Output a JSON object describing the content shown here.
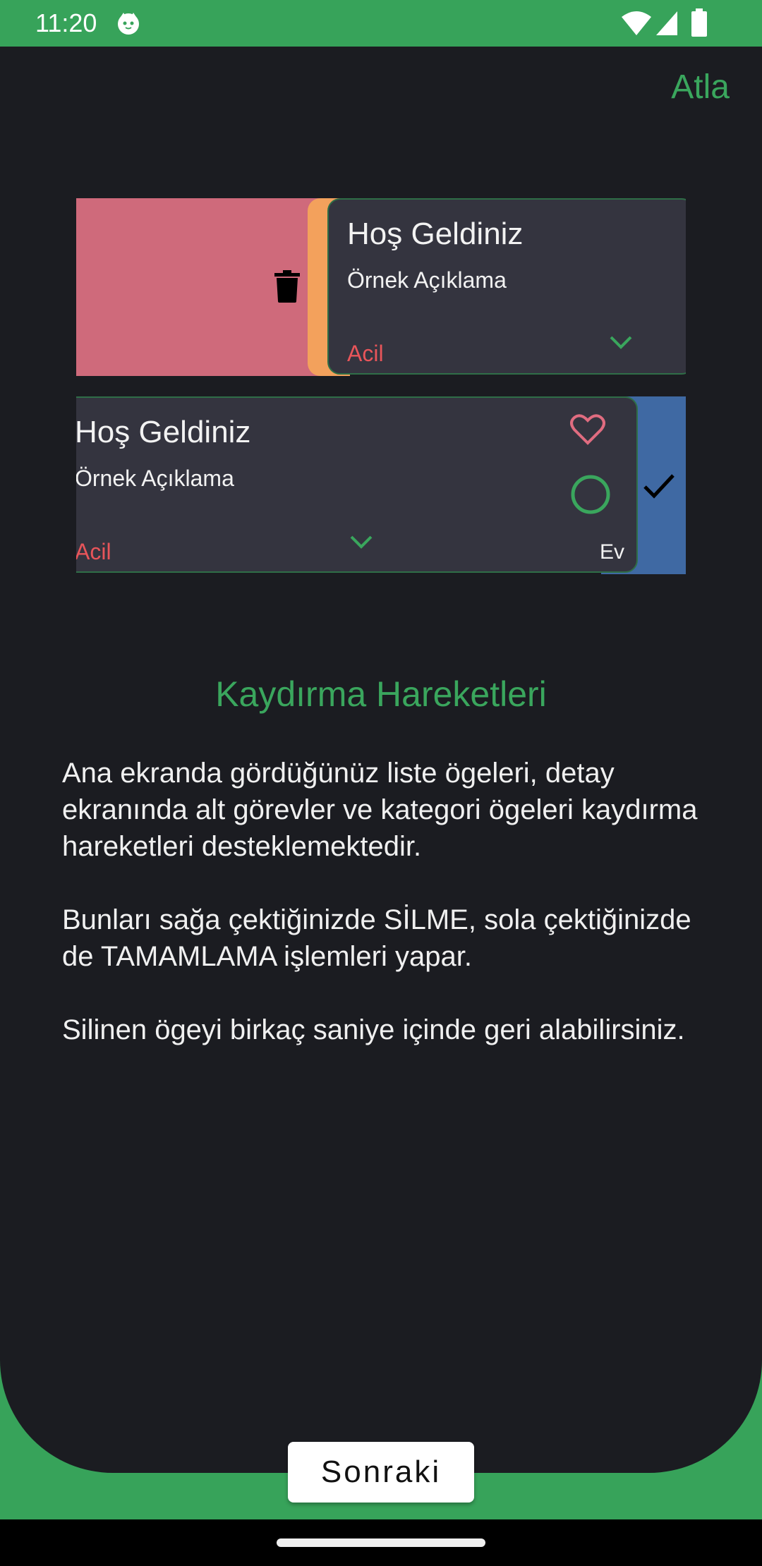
{
  "status_bar": {
    "time": "11:20",
    "icons": [
      "cat-icon",
      "wifi-icon",
      "signal-icon",
      "battery-icon"
    ]
  },
  "header": {
    "skip_label": "Atla"
  },
  "demo_cards": [
    {
      "title": "Hoş Geldiniz",
      "description": "Örnek Açıklama",
      "priority": "Acil",
      "swipe_action": "delete",
      "action_icon": "trash-icon"
    },
    {
      "title": "Hoş Geldiniz",
      "description": "Örnek Açıklama",
      "priority": "Acil",
      "category": "Ev",
      "swipe_action": "complete",
      "action_icon": "check-icon",
      "icons": [
        "heart-icon",
        "circle-icon"
      ]
    }
  ],
  "content": {
    "title": "Kaydırma Hareketleri",
    "paragraphs": [
      "Ana ekranda gördüğünüz liste ögeleri, detay ekranında alt görevler ve kategori ögeleri kaydırma hareketleri desteklemektedir.",
      "Bunları sağa çektiğinizde SİLME, sola çektiğinizde de TAMAMLAMA işlemleri yapar.",
      "Silinen ögeyi birkaç saniye içinde geri alabilirsiniz."
    ]
  },
  "footer": {
    "next_label": "Sonraki"
  },
  "colors": {
    "accent_green": "#37a35a",
    "background": "#1b1c21",
    "card": "#34343f",
    "delete_red": "#cf6a7b",
    "complete_blue": "#3f69a3",
    "priority_red": "#e8555a",
    "orange": "#f3a15c"
  }
}
